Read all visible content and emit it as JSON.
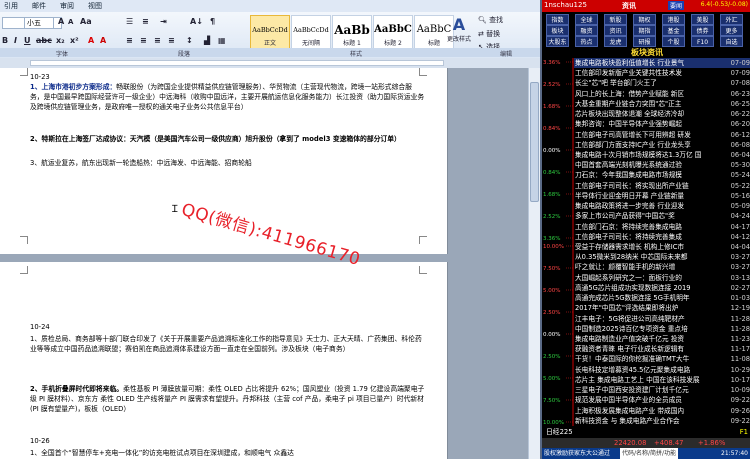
{
  "word": {
    "menu": [
      "引用",
      "邮件",
      "审阅",
      "视图"
    ],
    "font_name": "",
    "font_size": "小五",
    "styles": [
      {
        "sample": "AaBbCcDd",
        "caption": "正文",
        "active": true
      },
      {
        "sample": "AaBbCcDd",
        "caption": "无间隔",
        "active": false
      },
      {
        "sample": "AaBb",
        "caption": "标题 1",
        "active": false
      },
      {
        "sample": "AaBbC",
        "caption": "标题 2",
        "active": false
      },
      {
        "sample": "AaBbC",
        "caption": "标题",
        "active": false
      }
    ],
    "change_styles": "更改样式",
    "find": "查找",
    "replace": "替换",
    "select": "选择",
    "sections": {
      "font": "字体",
      "paragraph": "段落",
      "styles": "样式",
      "edit": "编辑"
    },
    "page1": {
      "date": "10-23",
      "p1_head": "1、上海市港初步方案形成：",
      "p1_body": "畅联股份（为跨国企业提供精益供应链管理服务）、华贸物流（主营现代物流，跨境一站形式综合服务，是中国最早跨国际经营许可一级企业）中远海科（收购中国远洋，主要开展航运信息化服务能力）长江投资（助力国际货运业务及跨境供应链管理业务，是政府唯一授权的通关电子业务公共信息平台）",
      "p2_head": "2、特斯拉在上海签厂达成协议：",
      "p2_body": "天汽模（是美国汽车公司一级供应商）旭升股份（拿到了 model3 变速箱体的部分订单）",
      "p3": "3、航运业复苏，航东出现新一轮造船热：中远海发、中远海能、招商轮船"
    },
    "page2": {
      "date": "10-24",
      "p1": "1、质检总局、商务部等十部门联合印发了《关于开展重要产品追溯标准化工作的指导意见》天士力、正大天晴、广药集团、科伦药业等等成立中国药品追溯联盟；赛伯凯在商品追溯体系建设方面一直走在全国前列。涉及板块（电子商务）",
      "p2_head": "2、手机折叠屏时代即将来临。",
      "p2_body": "柔性基板 PI 薄膜放量可期：柔性 OLED 占比将提升 62%；国风塑业（投资 1.79 亿建设高端聚电子级 PI 膜材料）、京东方 柔性 OLED 生产线将量产 PI 膜需求有望提升。丹邦科技（主营 cof 产品，柔电子 pi 项目已量产）时代新材(PI 膜有望量产)，板板（OLED）",
      "date2": "10-26",
      "p3": "1、全国首个“智慧停车+充电一体化”的访充电桩试点项目在深圳建成，和顺电气 众鑫达"
    },
    "watermark": "QQ(微信):411966170"
  },
  "stock": {
    "title": "1nschau125",
    "logo": "资讯",
    "highlight": "要闻",
    "topright": "6.4(-0.53/-0.08)",
    "nav_row1": [
      "指数",
      "全球",
      "新股",
      "期权",
      "港股",
      "美股",
      "外汇"
    ],
    "nav_row2": [
      "板块",
      "融资",
      "资讯",
      "期指",
      "基金",
      "债券",
      "更多"
    ],
    "nav_row3": [
      "大股东",
      "热点",
      "龙虎",
      "研报",
      "个股",
      "F10",
      "自选"
    ],
    "panel_title": "板块资讯",
    "chart_labels": [
      "3.36%",
      "2.52%",
      "1.68%",
      "0.84%",
      "0.00%",
      "0.84%",
      "1.68%",
      "2.52%",
      "3.36%",
      "10.00%",
      "7.50%",
      "5.00%",
      "2.50%",
      "0.00%",
      "2.50%",
      "5.00%",
      "7.50%",
      "10.00%"
    ],
    "news": [
      {
        "t": "集成电路板块盈利低值增长 行业景气",
        "d": "07-09"
      },
      {
        "t": "工信部印发新版产业关键共性技术发",
        "d": "07-09"
      },
      {
        "t": "长尘\"芯\"吧 举台部门火王了",
        "d": "07-08"
      },
      {
        "t": "风口上的长上海：借势产业赋能 新区",
        "d": "06-23"
      },
      {
        "t": "大基金重期产业链合力突围\"芯\"正主",
        "d": "06-25"
      },
      {
        "t": "芯片板块出现整体退潮 全球经济冷却",
        "d": "06-22"
      },
      {
        "t": "集邦咨询：中国半导体产业强势崛起",
        "d": "06-20"
      },
      {
        "t": "工信部电子司高管增长下可用辨超 研发",
        "d": "06-12"
      },
      {
        "t": "工信部部门方面支持IC产业 行业龙头享",
        "d": "06-08"
      },
      {
        "t": "集成电路十次月销市场规模将达1.3万亿 国",
        "d": "06-04"
      },
      {
        "t": "中国首套高端光刻机曝光系统通过验",
        "d": "05-30"
      },
      {
        "t": "刀石京：今年我国集成电路市场规模",
        "d": "05-24"
      },
      {
        "t": "工信部电子司司长：将实现出所产业链",
        "d": "05-22"
      },
      {
        "t": "半导体行业迎金明日开幕 产业链新量",
        "d": "05-16"
      },
      {
        "t": "集成电路政策将进一步完善 行业迎发",
        "d": "05-09"
      },
      {
        "t": "多家上市公司产品获得\"中国芯\"奖",
        "d": "04-24"
      },
      {
        "t": "工信部门石京：将持续完善集成电路",
        "d": "04-17"
      },
      {
        "t": "工信部电子司司长：将持续完善集成",
        "d": "04-12"
      },
      {
        "t": "受益于存储器需求增长 机构上修IC市",
        "d": "04-04"
      },
      {
        "t": "从0.35微米到28纳米 中芯国际未来都",
        "d": "03-27"
      },
      {
        "t": "吓之就让：颜覆智能手机的新兴增",
        "d": "03-27"
      },
      {
        "t": "大国崛起系列研究之一：面板行业的",
        "d": "03-13"
      },
      {
        "t": "高通5G芯片组成功实现数据连接 2019",
        "d": "02-27"
      },
      {
        "t": "高通完成芯片5G数据连接 5G手机明年",
        "d": "01-03"
      },
      {
        "t": "2017年\"中国芯\"评选结果即将出炉",
        "d": "12-19"
      },
      {
        "t": "江丰电子：5G将促进公司高纯靶材产",
        "d": "11-28"
      },
      {
        "t": "中国制造2025诗百亿专项资金 重点培",
        "d": "11-28"
      },
      {
        "t": "集成电路制造业产值突破千亿元 投资",
        "d": "11-23"
      },
      {
        "t": "获融资者青睐 电子行业成长新逻辑有",
        "d": "11-17"
      },
      {
        "t": "干货！中泰国际的你挖掘准确TMT大牛",
        "d": "11-08"
      },
      {
        "t": "长电科技定增募资45.5亿元聚集成电路",
        "d": "10-29"
      },
      {
        "t": "芯片主 集成电路工艺上 中国在该科技发展",
        "d": "10-17"
      },
      {
        "t": "三星电子中国西安投资建厂计划千亿元",
        "d": "10-09"
      },
      {
        "t": "规范发展中国半导体产业的全员成员",
        "d": "09-22"
      },
      {
        "t": "上海积极发展集成电路产业 带成国内",
        "d": "09-26"
      },
      {
        "t": "新科技资金 与 集成电路产业合作会",
        "d": "09-22"
      }
    ],
    "bottom_label": "日经225",
    "bottom_value": "22420.08",
    "bottom_change": "+408.47",
    "bottom_pct": "+1.86%",
    "bottom_ticker": "F1",
    "status_left": "股权激励获家东大公通过",
    "status_mid": "代码/名称/简拼/功能",
    "status_time": "21:57:40"
  }
}
